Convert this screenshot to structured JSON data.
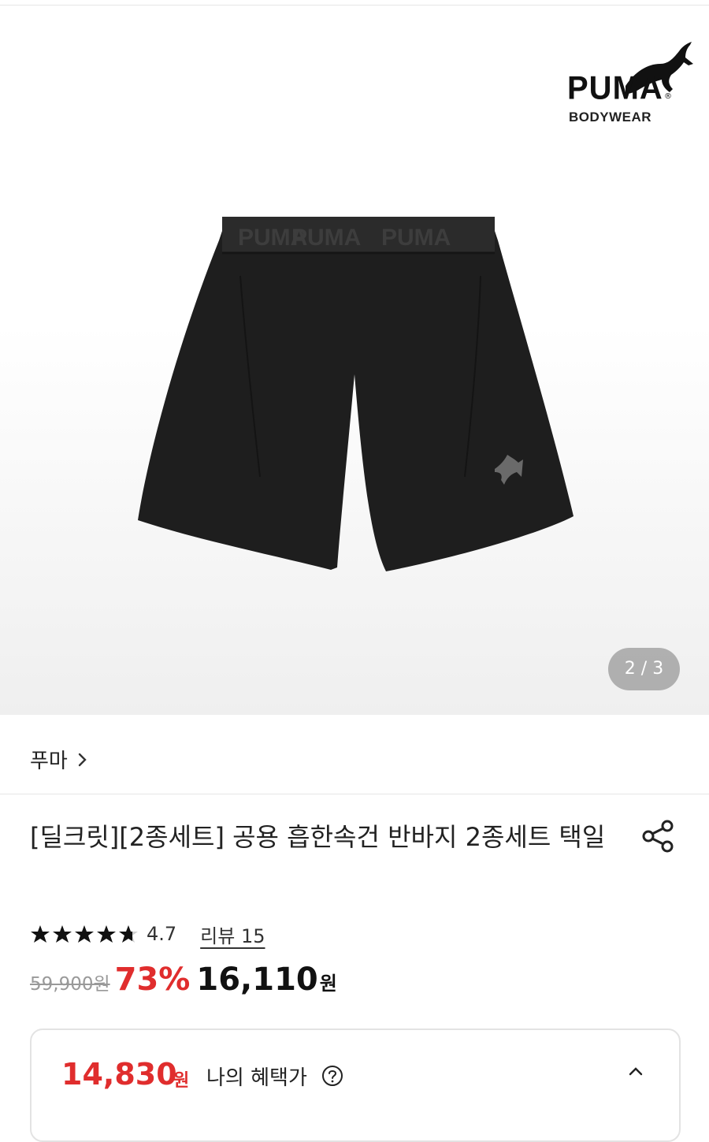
{
  "gallery": {
    "counter": "2 / 3",
    "logo_word": "PUMA",
    "logo_reg": "®",
    "logo_sub": "BODYWEAR",
    "waistband_text": "PUMA"
  },
  "brand": {
    "name": "푸마"
  },
  "product": {
    "title": "[딜크릿][2종세트] 공용 흡한속건 반바지 2종세트 택일",
    "rating": "4.7",
    "rating_value": 4.7,
    "review_label": "리뷰 15"
  },
  "price": {
    "original": "59,900원",
    "discount": "73%",
    "final": "16,110",
    "currency": "원"
  },
  "benefit": {
    "price": "14,830",
    "currency": "원",
    "label": "나의 혜택가"
  },
  "colors": {
    "discount_red": "#e02d2d",
    "text_dark": "#222222"
  }
}
